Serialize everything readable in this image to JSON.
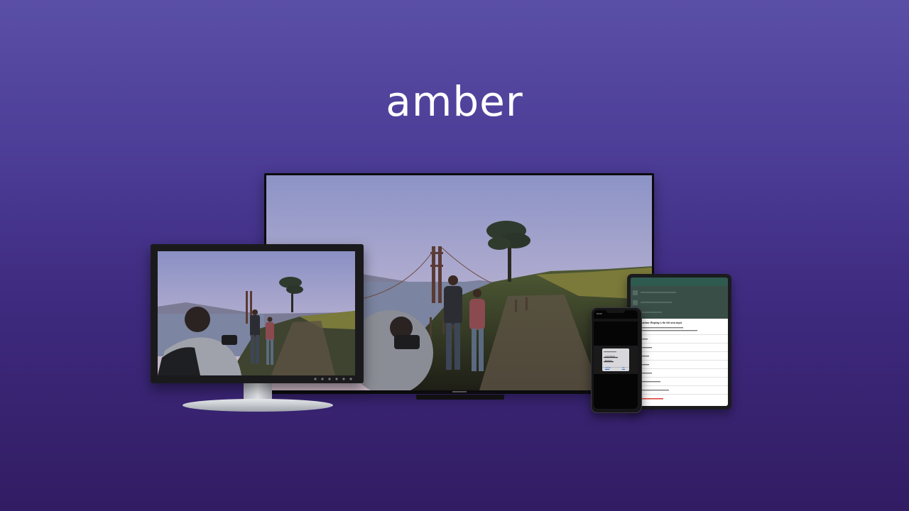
{
  "brand": {
    "logo_text": "amber"
  },
  "devices": {
    "tv": {
      "content": "landscape-photo"
    },
    "monitor": {
      "content": "landscape-photo"
    },
    "tablet": {
      "app": "file-list",
      "dialog_title": "Amber Replay Life till sea.mp4"
    },
    "phone": {
      "status_time": "10:24",
      "dialog_item_1": "Living Room",
      "dialog_item_2": "Bedroom",
      "cancel_label": "Cancel",
      "ok_label": "OK"
    }
  },
  "colors": {
    "background_top": "#5a4fa6",
    "background_bottom": "#321c63",
    "logo": "#ffffff",
    "tablet_header": "#2c4a43"
  }
}
